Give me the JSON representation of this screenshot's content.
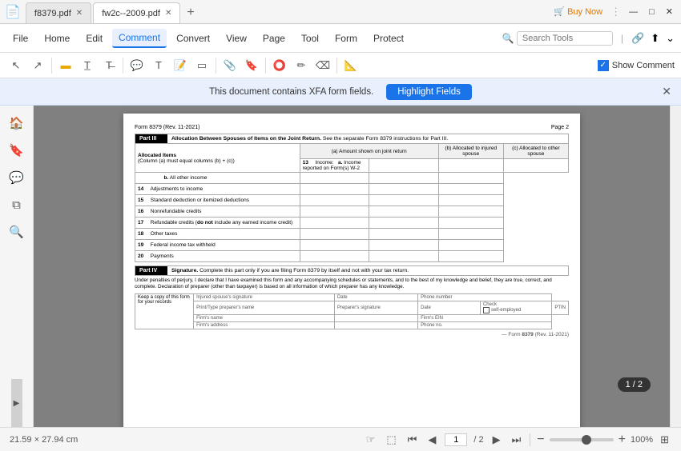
{
  "app": {
    "icon": "📄"
  },
  "titlebar": {
    "tabs": [
      {
        "id": "tab1",
        "label": "f8379.pdf",
        "active": false
      },
      {
        "id": "tab2",
        "label": "fw2c--2009.pdf",
        "active": true
      }
    ],
    "add_tab": "+",
    "buy_now": "Buy Now",
    "minimize": "—",
    "maximize": "□",
    "close": "✕"
  },
  "menubar": {
    "items": [
      "File",
      "Home",
      "Edit",
      "Comment",
      "Convert",
      "View",
      "Page",
      "Tool",
      "Form",
      "Protect"
    ],
    "active": "Comment",
    "search_placeholder": "Search Tools",
    "show_comment_label": "Show Comment"
  },
  "toolbar": {
    "icons": [
      "cursor",
      "arrow",
      "highlight",
      "underline",
      "strikeout",
      "note",
      "text",
      "box",
      "attachment",
      "stamp",
      "shape",
      "measure"
    ]
  },
  "banner": {
    "message": "This document contains XFA form fields.",
    "button": "Highlight Fields",
    "close": "✕"
  },
  "sidebar": {
    "icons": [
      "home",
      "bookmark",
      "comment",
      "layers",
      "search"
    ]
  },
  "pdf": {
    "form_id": "Form 8379 (Rev. 11-2021)",
    "page": "Page 2",
    "part3": {
      "title": "Part III",
      "heading": "Allocation Between Spouses of Items on the Joint Return.",
      "note": "See the separate Form 8379 instructions for Part III.",
      "col_a": "(a) Amount shown on joint return",
      "col_b": "(b) Allocated to injured spouse",
      "col_c": "(c) Allocated to other spouse",
      "subheading": "Allocated Items",
      "col_desc": "(Column (a) must equal columns (b) + (c))",
      "rows": [
        {
          "num": "13",
          "label": "Income:",
          "sub": "a.",
          "sub_label": "Income reported on Form(s) W-2"
        },
        {
          "num": "",
          "label": "",
          "sub": "b.",
          "sub_label": "All other income"
        },
        {
          "num": "14",
          "label": "Adjustments to income",
          "sub": "",
          "sub_label": ""
        },
        {
          "num": "15",
          "label": "Standard deduction or itemized deductions",
          "sub": "",
          "sub_label": ""
        },
        {
          "num": "16",
          "label": "Nonrefundable credits",
          "sub": "",
          "sub_label": ""
        },
        {
          "num": "17",
          "label": "Refundable credits (do not include any earned income credit)",
          "sub": "",
          "sub_label": ""
        },
        {
          "num": "18",
          "label": "Other taxes",
          "sub": "",
          "sub_label": ""
        },
        {
          "num": "19",
          "label": "Federal income tax withheld",
          "sub": "",
          "sub_label": ""
        },
        {
          "num": "20",
          "label": "Payments",
          "sub": "",
          "sub_label": ""
        }
      ]
    },
    "part4": {
      "title": "Part IV",
      "heading": "Signature.",
      "description": "Complete this part only if you are filing Form 8379 by itself and not with your tax return.",
      "perjury_text": "Under penalties of perjury, I declare that I have examined this form and any accompanying schedules or statements, and to the best of my knowledge and belief, they are true, correct, and complete. Declaration of preparer (other than taxpayer) is based on all information of which preparer has any knowledge.",
      "keep_copy": "Keep a copy of this form for your records",
      "fields": {
        "injured_sig": "Injured spouse's signature",
        "date": "Date",
        "phone": "Phone number",
        "preparer_name": "Print/Type preparer's name",
        "preparer_sig": "Preparer's signature",
        "date2": "Date",
        "check": "Check",
        "self_employed": "self-employed",
        "ptin": "PTIN",
        "firm_name": "Firm's name",
        "firm_ein": "Firm's EIN",
        "firm_address": "Firm's address",
        "phone_no": "Phone no."
      }
    }
  },
  "statusbar": {
    "dimensions": "21.59 × 27.94 cm",
    "cursor_icon": "hand",
    "select_icon": "cursor",
    "nav_first": "⏮",
    "nav_prev": "◀",
    "nav_next": "▶",
    "nav_last": "⏭",
    "page_current": "1",
    "page_total": "/ 2",
    "zoom_minus": "−",
    "zoom_plus": "+",
    "zoom_level": "100%",
    "fit_icon": "⊞"
  },
  "page_indicator": {
    "label": "1 / 2"
  }
}
